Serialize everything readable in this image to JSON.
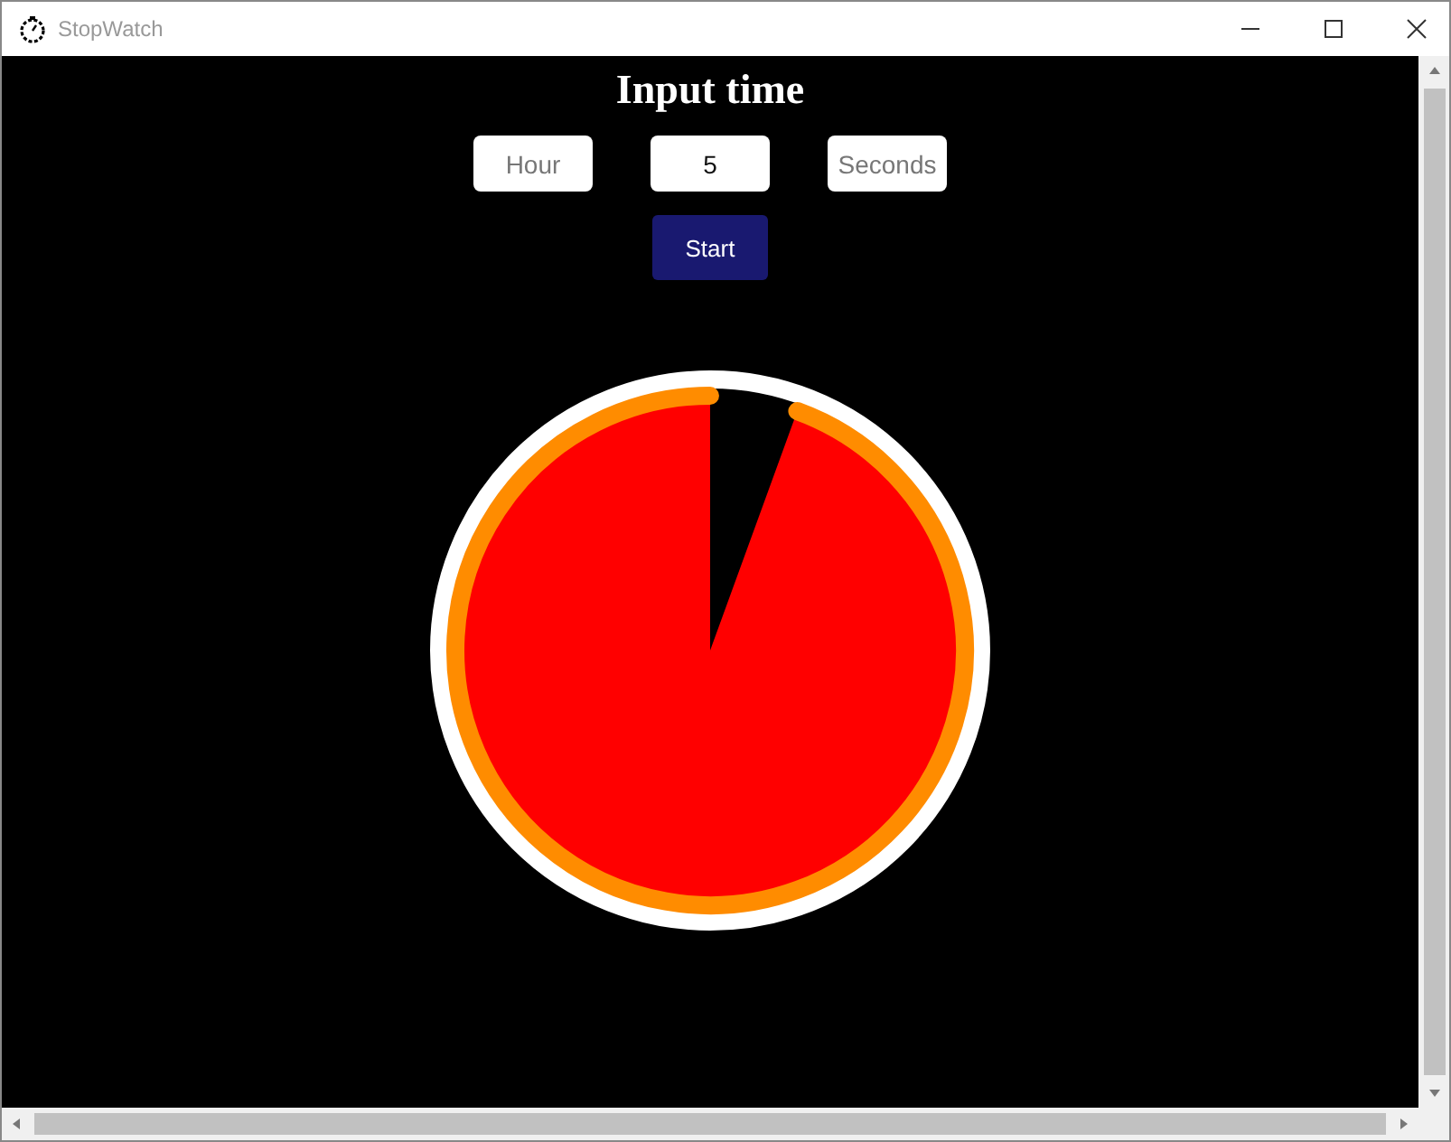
{
  "window": {
    "title": "StopWatch"
  },
  "heading": "Input time",
  "fields": [
    {
      "placeholder": "Hour"
    },
    {
      "value": "5"
    },
    {
      "placeholder": "Seconds"
    }
  ],
  "start_button": "Start"
}
